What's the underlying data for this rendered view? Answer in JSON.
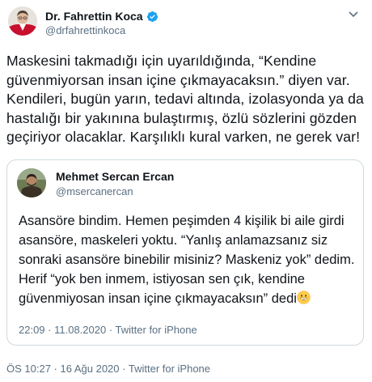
{
  "tweet": {
    "author_name": "Dr. Fahrettin Koca",
    "author_handle": "@drfahrettinkoca",
    "text": "Maskesini takmadığı için uyarıldığında, “Kendine güvenmiyorsan insan içine çıkmayacaksın.” diyen var. Kendileri, bugün yarın, tedavi altında, izolasyonda ya da hastalığı bir yakınına bulaştırmış, özlü sözlerini gözden geçiriyor olacaklar. Karşılıklı kural varken, ne gerek var!",
    "time": "ÖS 10:27",
    "date": "16 Ağu 2020",
    "separator": " · ",
    "source": "Twitter for iPhone"
  },
  "quoted": {
    "author_name": "Mehmet Sercan Ercan",
    "author_handle": "@msercanercan",
    "text": "Asansöre bindim. Hemen peşimden 4 kişilik bi aile girdi asansöre, maskeleri yoktu. “Yanlış anlamazsanız siz sonraki asansöre binebilir misiniz? Maskeniz yok” dedim. Herif “yok ben inmem, istiyosan sen çık, kendine güvenmiyosan insan içine çıkmayacaksın” dedi",
    "time": "22:09",
    "date": "11.08.2020",
    "separator": " · ",
    "source": "Twitter for iPhone"
  },
  "icons": {
    "verified": "verified-badge-icon",
    "more": "chevron-down-icon",
    "emoji": "grinning-face-emoji"
  },
  "colors": {
    "text": "#0f1419",
    "secondary": "#5b7083",
    "verified": "#1da1f2",
    "border": "#cfd9de"
  }
}
